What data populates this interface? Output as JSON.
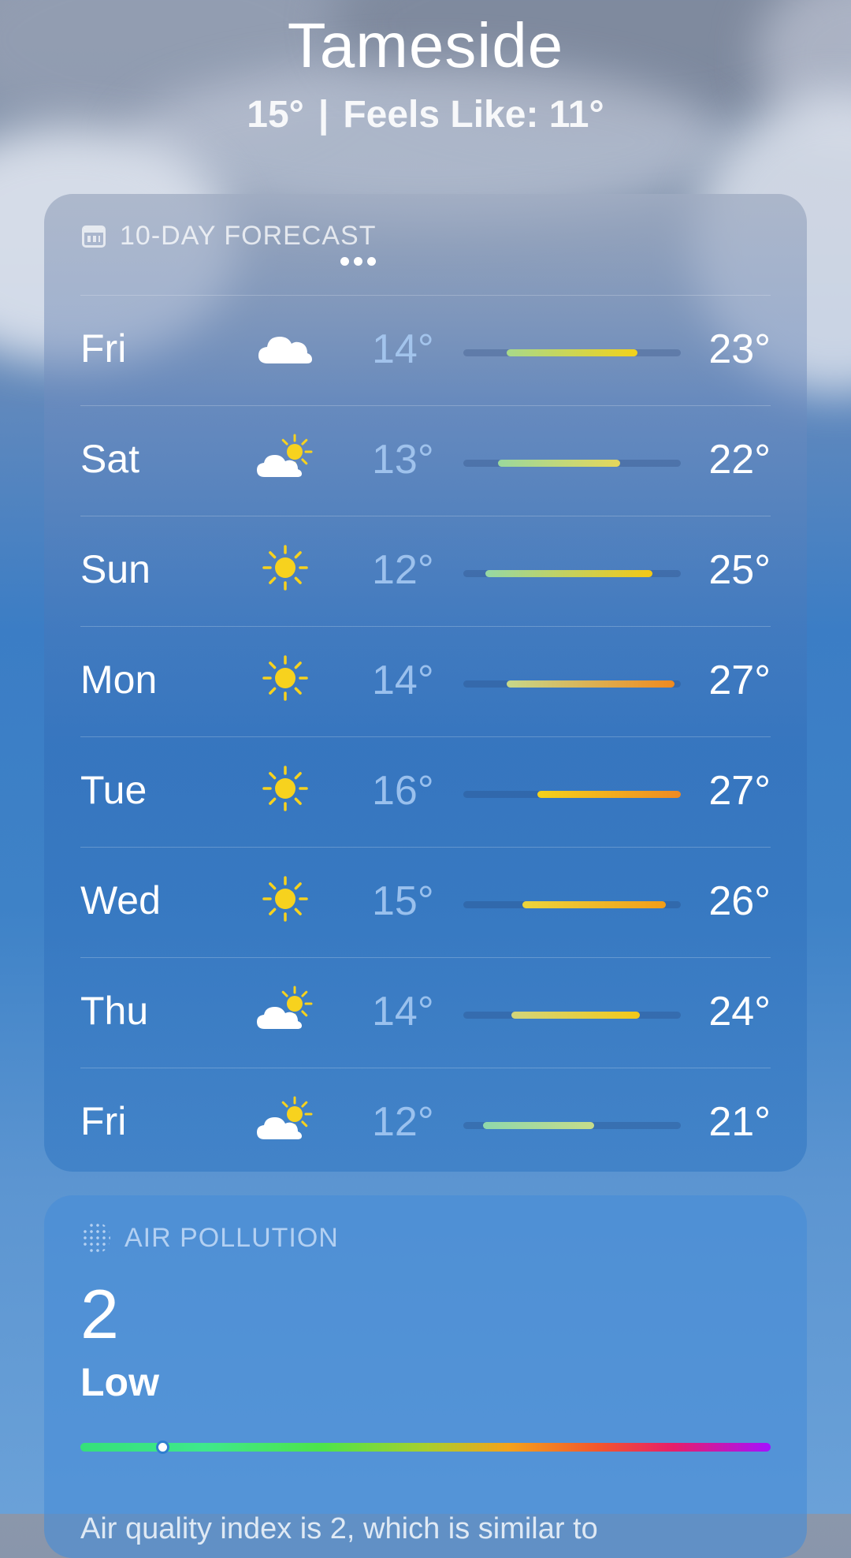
{
  "location": {
    "city": "Tameside",
    "temp": "15°",
    "separator": "|",
    "feels_like": "Feels Like: 11°"
  },
  "forecast": {
    "title": "10-DAY FORECAST",
    "icon": "calendar-icon",
    "days": [
      {
        "day": "Fri",
        "icon": "cloud",
        "low": "14°",
        "high": "23°",
        "bar_start": 0.2,
        "bar_end": 0.8,
        "colors": [
          "#a8d98a",
          "#f2d21b"
        ]
      },
      {
        "day": "Sat",
        "icon": "partly-cloudy",
        "low": "13°",
        "high": "22°",
        "bar_start": 0.16,
        "bar_end": 0.72,
        "colors": [
          "#9ad89c",
          "#e6d75a"
        ]
      },
      {
        "day": "Sun",
        "icon": "sun",
        "low": "12°",
        "high": "25°",
        "bar_start": 0.1,
        "bar_end": 0.87,
        "colors": [
          "#96d8a4",
          "#f5c814"
        ]
      },
      {
        "day": "Mon",
        "icon": "sun",
        "low": "14°",
        "high": "27°",
        "bar_start": 0.2,
        "bar_end": 0.97,
        "colors": [
          "#c7d88a",
          "#f08a1e"
        ]
      },
      {
        "day": "Tue",
        "icon": "sun",
        "low": "16°",
        "high": "27°",
        "bar_start": 0.34,
        "bar_end": 1.0,
        "colors": [
          "#f5d21a",
          "#ef8a22"
        ]
      },
      {
        "day": "Wed",
        "icon": "sun",
        "low": "15°",
        "high": "26°",
        "bar_start": 0.27,
        "bar_end": 0.93,
        "colors": [
          "#ecd53b",
          "#f29d18"
        ]
      },
      {
        "day": "Thu",
        "icon": "partly-cloudy",
        "low": "14°",
        "high": "24°",
        "bar_start": 0.22,
        "bar_end": 0.81,
        "colors": [
          "#d3d57a",
          "#f3c818"
        ]
      },
      {
        "day": "Fri",
        "icon": "partly-cloudy",
        "low": "12°",
        "high": "21°",
        "bar_start": 0.09,
        "bar_end": 0.6,
        "colors": [
          "#8fd8ab",
          "#c6dc8a"
        ]
      }
    ]
  },
  "air_pollution": {
    "title": "AIR POLLUTION",
    "icon": "air-particles-icon",
    "value": "2",
    "level": "Low",
    "scale_position": 0.115,
    "description": "Air quality index is 2, which is similar to"
  }
}
